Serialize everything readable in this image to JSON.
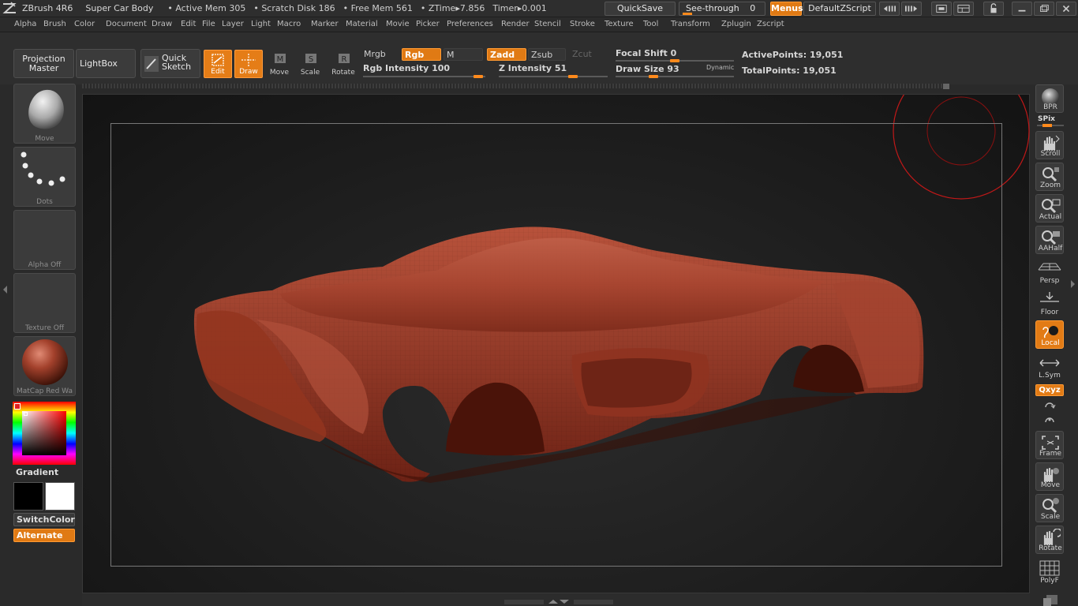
{
  "titlebar": {
    "app": "ZBrush 4R6",
    "document": "Super Car Body",
    "stats": {
      "active_mem": "• Active Mem 305",
      "scratch_disk": "• Scratch Disk 186",
      "free_mem": "• Free Mem 561",
      "ztime": "• ZTime▸7.856",
      "timer": "Timer▸0.001"
    },
    "quicksave": "QuickSave",
    "see_through_label": "See-through",
    "see_through_value": "0",
    "menus": "Menus",
    "default_zscript": "DefaultZScript"
  },
  "menubar": {
    "items": [
      "Alpha",
      "Brush",
      "Color",
      "Document",
      "Draw",
      "Edit",
      "File",
      "Layer",
      "Light",
      "Macro",
      "Marker",
      "Material",
      "Movie",
      "Picker",
      "Preferences",
      "Render",
      "Stencil",
      "Stroke",
      "Texture",
      "Tool",
      "Transform",
      "Zplugin",
      "Zscript"
    ]
  },
  "shelf": {
    "projection_master": [
      "Projection",
      "Master"
    ],
    "lightbox": "LightBox",
    "quick_sketch": [
      "Quick",
      "Sketch"
    ],
    "tools": {
      "edit": "Edit",
      "draw": "Draw",
      "move": "Move",
      "scale": "Scale",
      "rotate": "Rotate"
    },
    "mrgb": "Mrgb",
    "rgb": "Rgb",
    "m": "M",
    "zadd": "Zadd",
    "zsub": "Zsub",
    "zcut": "Zcut",
    "rgb_intensity": "Rgb Intensity 100",
    "z_intensity": "Z Intensity 51",
    "focal_shift": "Focal Shift 0",
    "draw_size": "Draw Size 93",
    "dynamic": "Dynamic",
    "active_points": "ActivePoints: 19,051",
    "total_points": "TotalPoints: 19,051"
  },
  "lefttray": {
    "brush": "Move",
    "stroke": "Dots",
    "alpha": "Alpha Off",
    "texture": "Texture Off",
    "material": "MatCap Red Wa",
    "gradient": "Gradient",
    "switch_color": "SwitchColor",
    "alternate": "Alternate"
  },
  "righttray": {
    "bpr": "BPR",
    "spix": "SPix",
    "scroll": "Scroll",
    "zoom": "Zoom",
    "actual": "Actual",
    "aahalf": "AAHalf",
    "persp": "Persp",
    "floor": "Floor",
    "local": "Local",
    "lsym": "L.Sym",
    "xyz": "Qxyz",
    "frame": "Frame",
    "move": "Move",
    "scale": "Scale",
    "rotate": "Rotate",
    "polyf": "PolyF"
  },
  "colors": {
    "accent": "#e07a14",
    "model": "#a8402c",
    "brush_cursor": "#c01818"
  }
}
